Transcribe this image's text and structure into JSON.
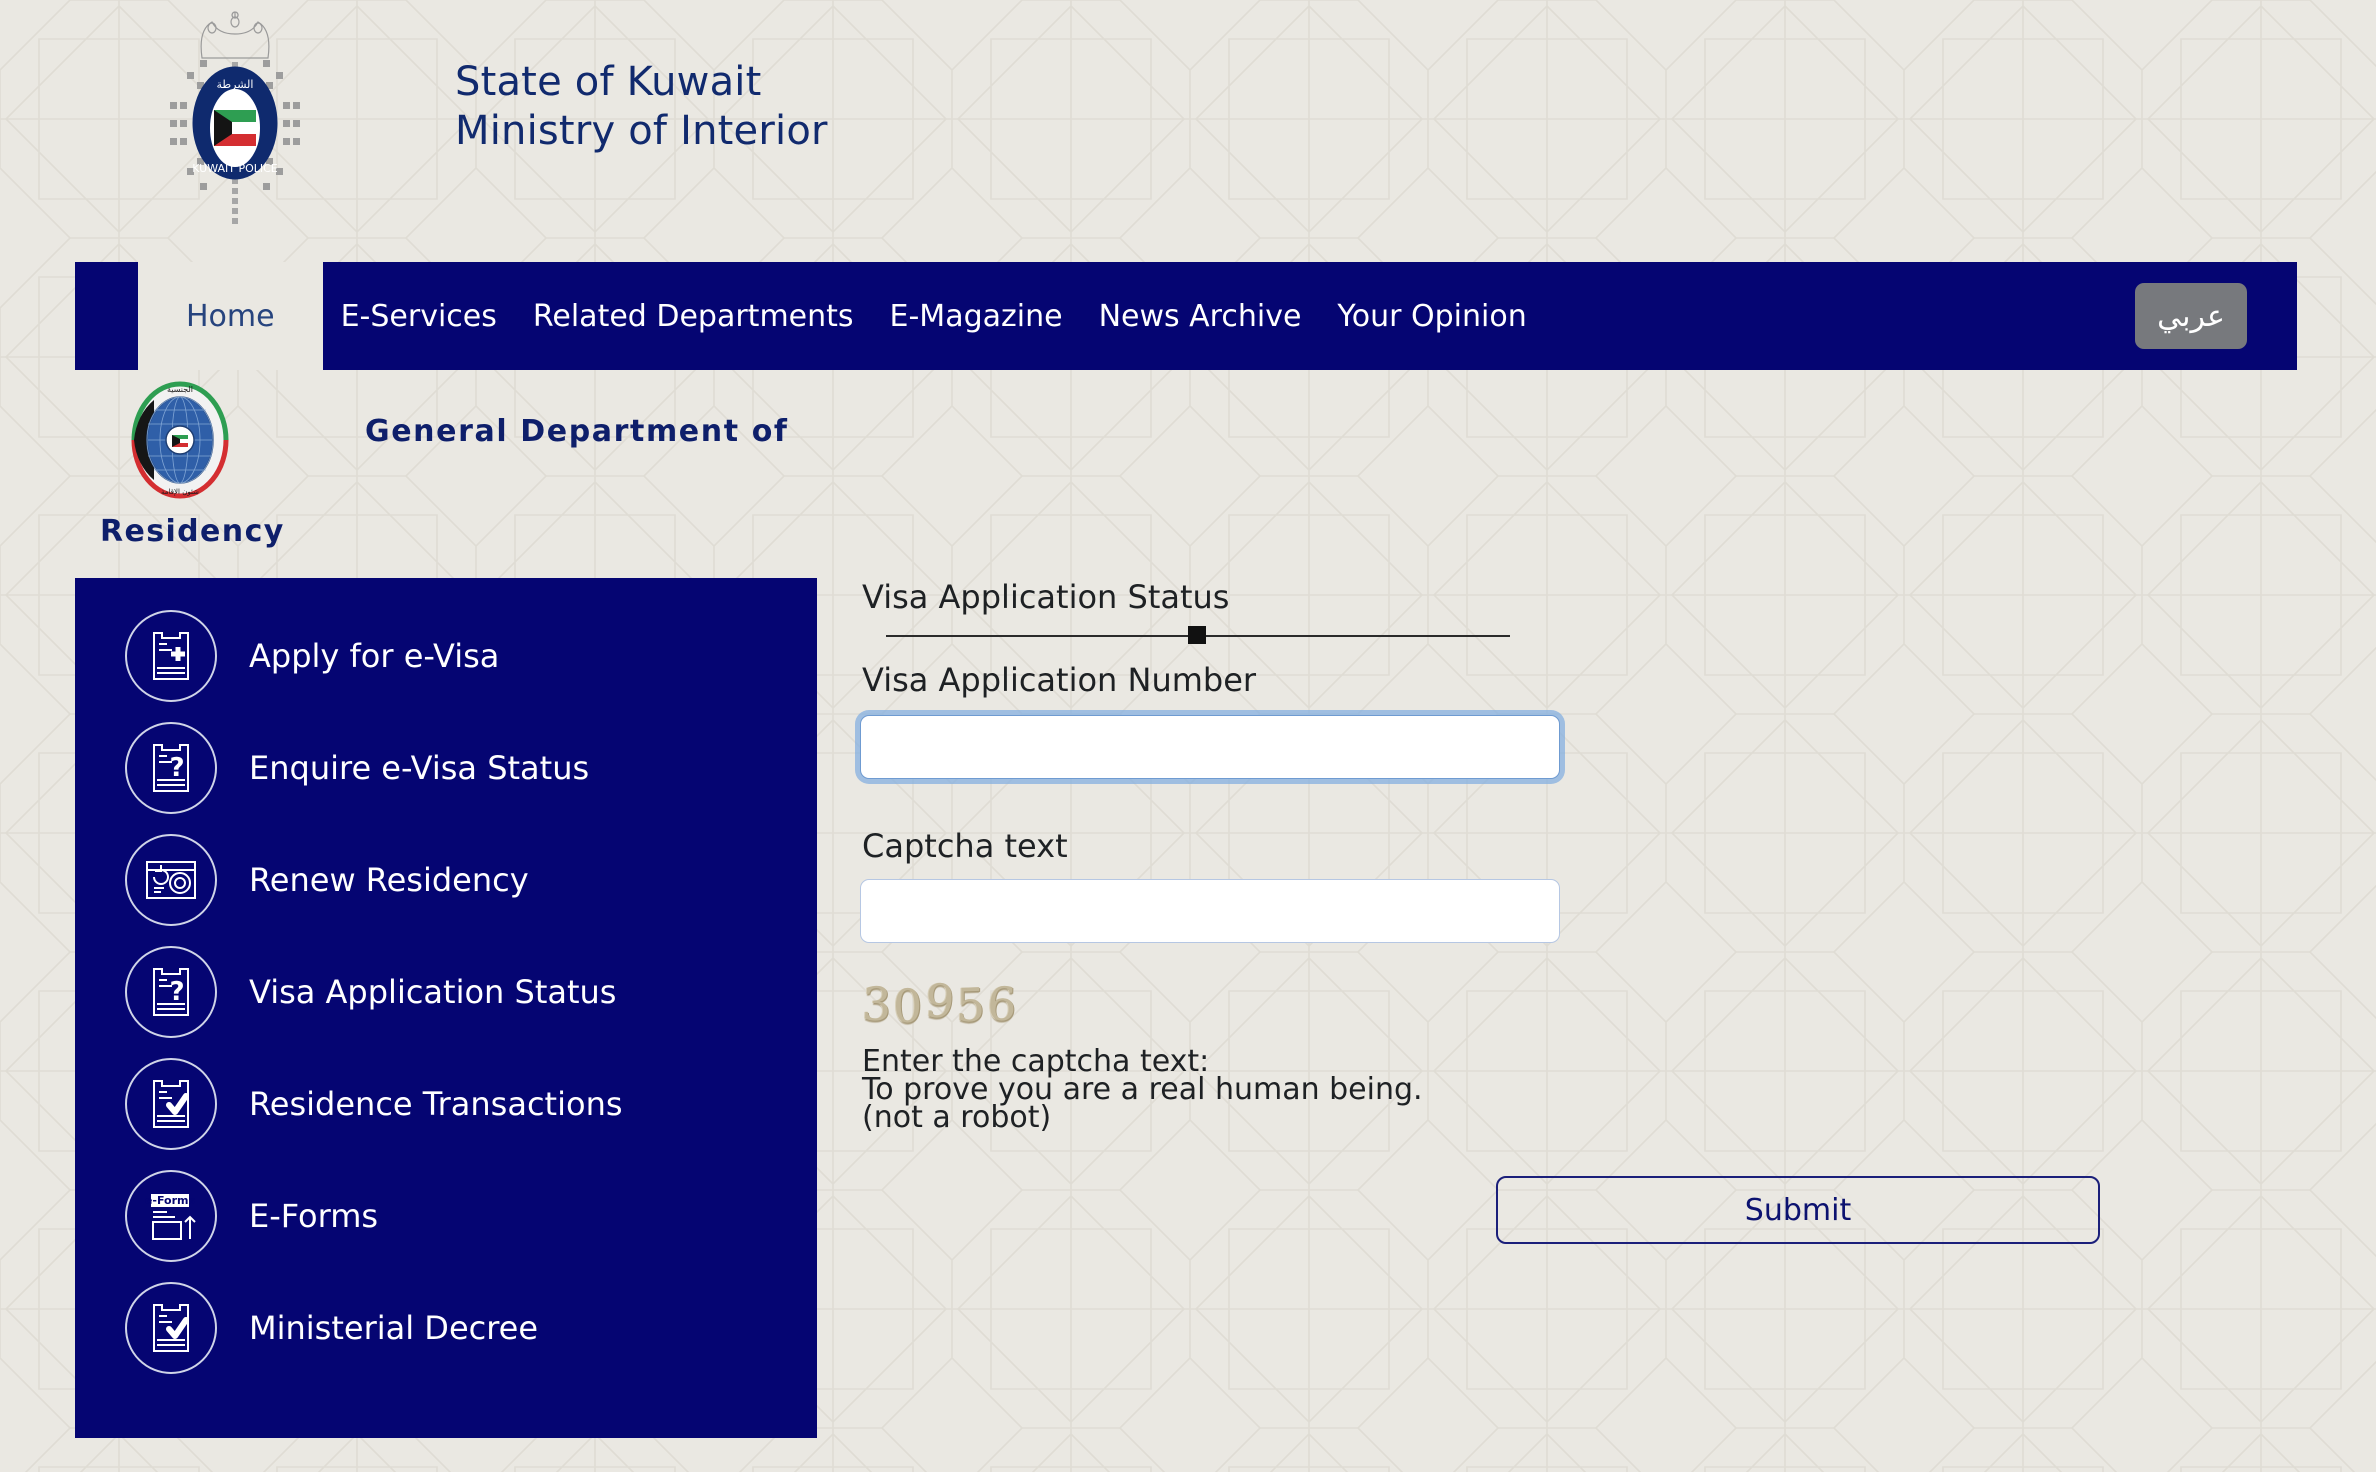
{
  "header": {
    "title_line1": "State of Kuwait",
    "title_line2": "Ministry of Interior",
    "crest_icon": "kuwait-police-crest-icon"
  },
  "nav": {
    "items": [
      {
        "label": "Home",
        "active": true
      },
      {
        "label": "E-Services",
        "active": false
      },
      {
        "label": "Related Departments",
        "active": false
      },
      {
        "label": "E-Magazine",
        "active": false
      },
      {
        "label": "News Archive",
        "active": false
      },
      {
        "label": "Your Opinion",
        "active": false
      }
    ],
    "language_button": "عربي",
    "background_color": "#050572",
    "active_background": "#eae8e2",
    "active_text_color": "#27447e"
  },
  "department": {
    "title_line1": "General Department of",
    "title_line2": "Residency",
    "logo_icon": "residency-department-emblem-icon",
    "title_color": "#0e1f6b"
  },
  "sidebar": {
    "background_color": "#050572",
    "items": [
      {
        "label": "Apply for e-Visa",
        "icon": "document-plus-icon"
      },
      {
        "label": "Enquire e-Visa Status",
        "icon": "document-question-icon"
      },
      {
        "label": "Renew Residency",
        "icon": "residency-card-refresh-icon"
      },
      {
        "label": "Visa Application Status",
        "icon": "document-question-icon"
      },
      {
        "label": "Residence Transactions",
        "icon": "document-check-icon"
      },
      {
        "label": "E-Forms",
        "icon": "e-forms-upload-icon"
      },
      {
        "label": "Ministerial Decree",
        "icon": "document-check-icon"
      }
    ]
  },
  "form": {
    "heading": "Visa Application Status",
    "visa_number_label": "Visa Application Number",
    "visa_number_value": "",
    "visa_number_placeholder": "",
    "captcha_label": "Captcha text",
    "captcha_value": "",
    "captcha_placeholder": "",
    "captcha_image_text": "30956",
    "captcha_note_line1": "Enter the captcha text:",
    "captcha_note_line2": "To prove you are a real human being.",
    "captcha_note_line3": "(not a robot)",
    "submit_label": "Submit",
    "submit_border_color": "#1b1f7a",
    "focused_field": "visa_number"
  },
  "page": {
    "background_color": "#eae8e2",
    "pattern": "islamic-eight-point-star"
  }
}
